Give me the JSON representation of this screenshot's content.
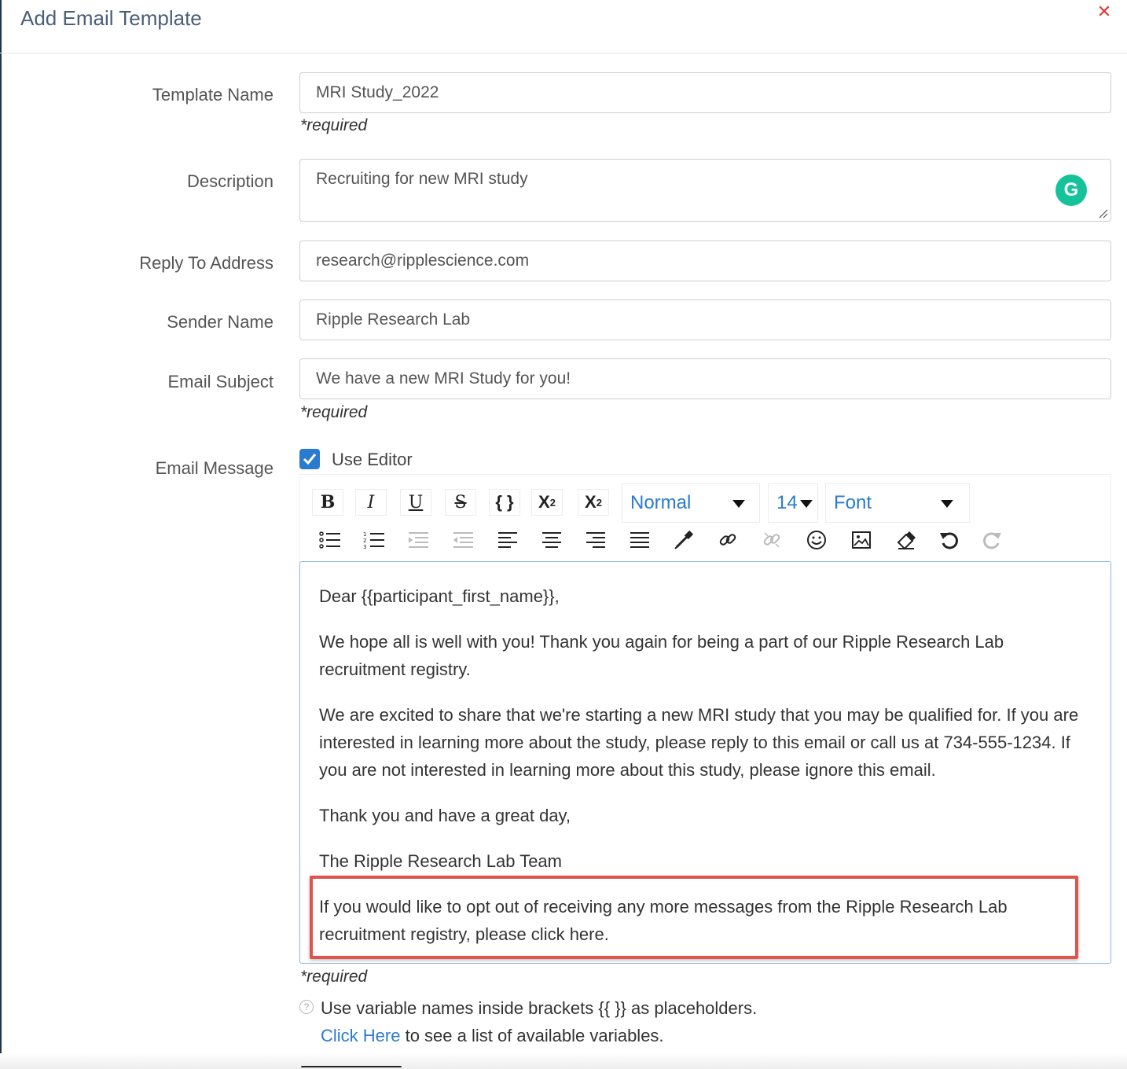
{
  "modal": {
    "title": "Add Email Template",
    "close_icon": "close-icon"
  },
  "form": {
    "template_name": {
      "label": "Template Name",
      "value": "MRI Study_2022",
      "note": "*required"
    },
    "description": {
      "label": "Description",
      "value": "Recruiting for new MRI study"
    },
    "reply_to": {
      "label": "Reply To Address",
      "value": "research@ripplescience.com"
    },
    "sender_name": {
      "label": "Sender Name",
      "value": "Ripple Research Lab"
    },
    "email_subject": {
      "label": "Email Subject",
      "value": "We have a new MRI Study for you!",
      "note": "*required"
    },
    "email_message": {
      "label": "Email Message",
      "use_editor_label": "Use Editor",
      "use_editor_checked": true,
      "note": "*required"
    }
  },
  "toolbar": {
    "bold": "B",
    "italic": "I",
    "underline": "U",
    "strike": "S",
    "code": "{ }",
    "superscript_base": "X",
    "superscript_exp": "2",
    "subscript_base": "X",
    "subscript_exp": "2",
    "paragraph_select": "Normal",
    "size_select": "14",
    "font_select": "Font"
  },
  "editor": {
    "paragraphs": [
      "Dear {{participant_first_name}},",
      "We hope all is well with you! Thank you again for being a part of our Ripple Research Lab recruitment registry.",
      "We are excited to share that we're starting a new MRI study that you may be qualified for. If you are interested in learning more about the study, please reply to this email or call us at 734-555-1234. If you are not interested in learning more about this study, please ignore this email.",
      "Thank you and have a great day,",
      "The Ripple Research Lab Team",
      "If you would like to opt out of receiving any more messages from the Ripple Research Lab recruitment registry, please click here."
    ]
  },
  "help": {
    "icon_text": "?",
    "line1": "Use variable names inside brackets {{ }} as placeholders.",
    "link_text": "Click Here",
    "line2_rest": " to see a list of available variables."
  },
  "colors": {
    "accent": "#2a7bd0",
    "highlight_border": "#e0544c",
    "grammarly": "#15c39a",
    "close": "#e0382f"
  }
}
